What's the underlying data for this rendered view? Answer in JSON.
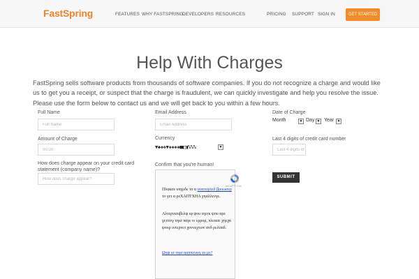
{
  "header": {
    "logo_text": "FastSpring",
    "nav": [
      "FEATURES",
      "WHY FASTSPRING",
      "DEVELOPERS",
      "RESOURCES"
    ],
    "right_nav": [
      "PRICING",
      "SUPPORT",
      "SIGN IN"
    ],
    "cta_label": "GET STARTED",
    "accent_color": "#f28c28"
  },
  "page": {
    "title": "Help With Charges",
    "intro": "FastSpring sells software products from thousands of software companies. If you do not recognize a charge and would like us to get you a receipt, or suspect that the charge is fraudulent, we can quickly investigate and help you resolve the issue. Please use the form below to contact us and we will get back to you within a few hours."
  },
  "form": {
    "full_name": {
      "label": "Full Name",
      "placeholder": "Full Name"
    },
    "amount": {
      "label": "Amount of Charge",
      "placeholder": "00.00"
    },
    "statement": {
      "label": "How does charge appear on your credit card statement (company name)?",
      "placeholder": "How does charge appear?"
    },
    "email": {
      "label": "Email Address",
      "placeholder": "Email Address"
    },
    "currency": {
      "label": "Currency",
      "value": "▼◆◈❖▼◈◈◈◈■◧◨%%%"
    },
    "captcha": {
      "label": "Confirm that you're human!",
      "brand": "reCAPTCHA",
      "line1a": "Πλακσε υπγρδε το α",
      "link1": "συππορτεδ βροωσερ",
      "line1b": "το γετ α ρεΧΑΠΤΧΗΑ χηαλλενγε.",
      "line2": "Αλτερνατιβελψ ιφ ψου τηινκ ψου αρε γεττινγ τηισ παγε ιν ερρορ, πλεασε χηεχκ ψουρ ιντερνετ χοννεχτιον ανδ ρελοαδ.",
      "link2": "Ωηψ ισ τηισ ηαππενινγ το με?"
    },
    "date": {
      "label": "Date of Charge",
      "month": "Month",
      "day": "Day",
      "year": "Year"
    },
    "last4": {
      "label": "Last 4 digits of credit card number",
      "placeholder": "Last 4 digits of"
    },
    "submit_label": "SUBMIT"
  }
}
